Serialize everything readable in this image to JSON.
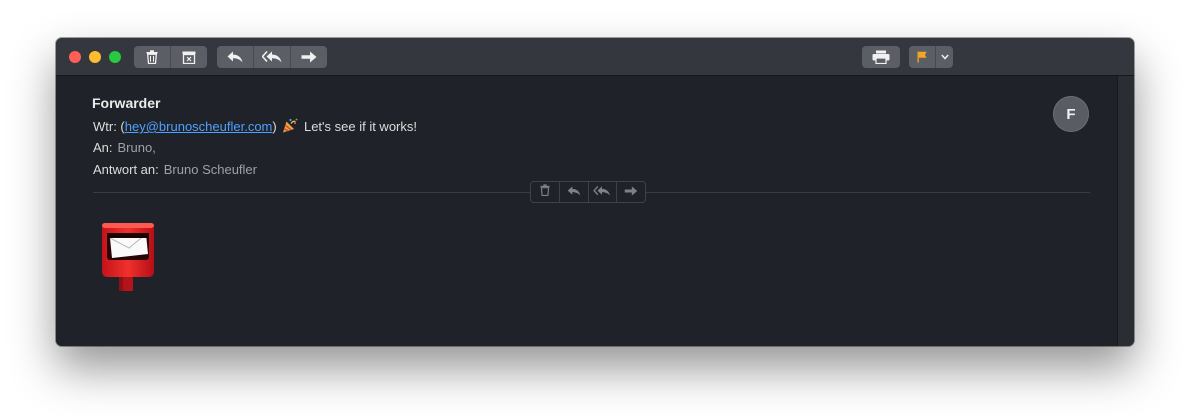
{
  "toolbar": {
    "delete": "trash-icon",
    "archive": "archive-icon",
    "reply": "reply-icon",
    "reply_all": "reply-all-icon",
    "forward": "forward-icon",
    "print": "printer-icon",
    "flag": "flag-icon",
    "flag_color": "#f5a623"
  },
  "message": {
    "sender": "Forwarder",
    "subject_prefix": "Wtr: (",
    "subject_email": "hey@brunoscheufler.com",
    "subject_close": ")",
    "subject_emoji": "party-popper-icon",
    "subject_text": "Let's see if it works!",
    "to_label": "An:",
    "to_value": "Bruno,",
    "reply_to_label": "Antwort an:",
    "reply_to_value": "Bruno Scheufler",
    "avatar_initial": "F",
    "body_image": "postbox-icon"
  },
  "colors": {
    "accent_link": "#4fa0ff",
    "window_bg": "#1f2329",
    "titlebar_bg": "#34373d"
  }
}
